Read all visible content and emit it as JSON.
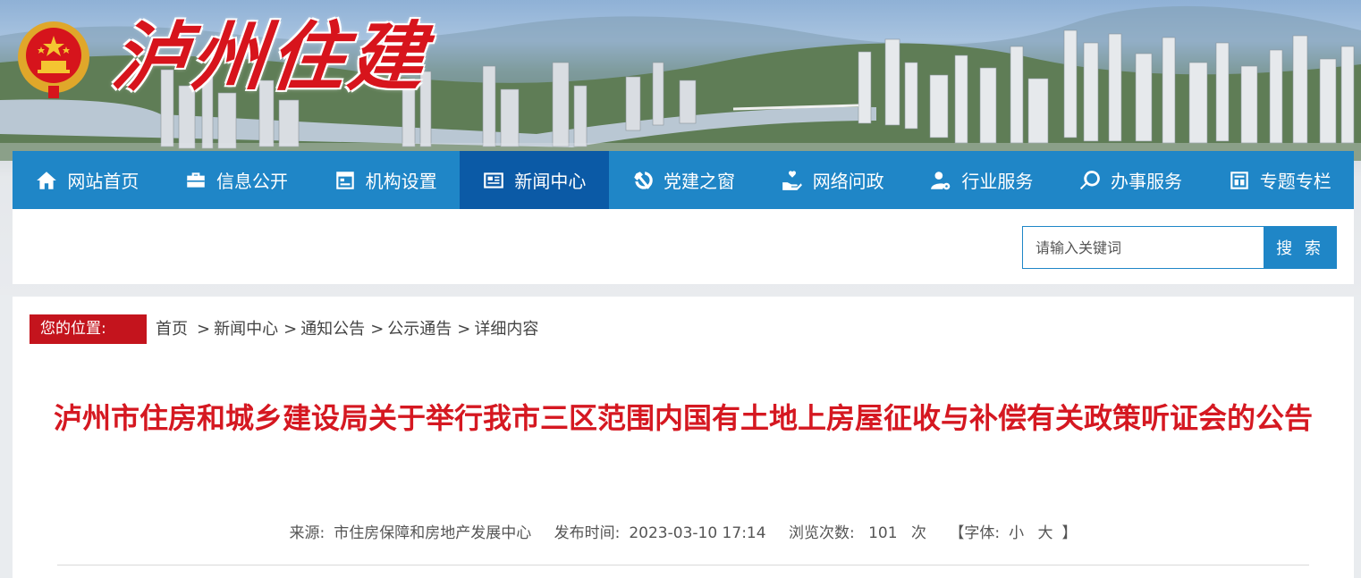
{
  "header": {
    "site_logo": "泸州住建",
    "colors": {
      "brand_red": "#d7141c",
      "nav_blue": "#1f86c7",
      "nav_active": "#0b5aa6"
    }
  },
  "nav": {
    "items": [
      {
        "label": "网站首页",
        "icon": "home-icon"
      },
      {
        "label": "信息公开",
        "icon": "briefcase-icon"
      },
      {
        "label": "机构设置",
        "icon": "window-icon"
      },
      {
        "label": "新闻中心",
        "icon": "newspaper-icon",
        "active": true
      },
      {
        "label": "党建之窗",
        "icon": "hammer-sickle-icon"
      },
      {
        "label": "网络问政",
        "icon": "hand-heart-icon"
      },
      {
        "label": "行业服务",
        "icon": "user-gear-icon"
      },
      {
        "label": "办事服务",
        "icon": "search-icon"
      },
      {
        "label": "专题专栏",
        "icon": "grid-box-icon"
      }
    ]
  },
  "search": {
    "placeholder": "请输入关键词",
    "button_label": "搜 索"
  },
  "breadcrumb": {
    "badge": "您的位置:",
    "items": [
      "首页",
      "新闻中心",
      "通知公告",
      "公示通告",
      "详细内容"
    ]
  },
  "article": {
    "title": "泸州市住房和城乡建设局关于举行我市三区范围内国有土地上房屋征收与补偿有关政策听证会的公告",
    "source_label": "来源:",
    "source": "市住房保障和房地产发展中心",
    "date_label": "发布时间:",
    "date": "2023-03-10 17:14",
    "views_label": "浏览次数:",
    "views": "101",
    "views_unit": "次",
    "font_label_open": "【字体:",
    "font_small": "小",
    "font_large": "大",
    "font_label_close": "】"
  }
}
